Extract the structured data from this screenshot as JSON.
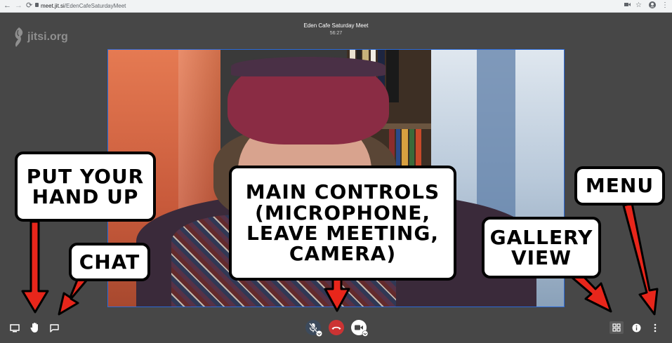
{
  "browser": {
    "nav_back": "←",
    "nav_forward": "→",
    "nav_reload": "⟳",
    "url_host": "meet.jit.si",
    "url_path": "/EdenCafeSaturdayMeet"
  },
  "meeting": {
    "logo_text": "jitsi.org",
    "title": "Eden Cafe Saturday Meet",
    "timer": "56:27"
  },
  "annotations": {
    "hand_up": "PUT YOUR HAND UP",
    "chat": "CHAT",
    "main_controls": "MAIN CONTROLS (MICROPHONE, LEAVE MEETING, CAMERA)",
    "gallery_view": "GALLERY VIEW",
    "menu": "MENU"
  },
  "toolbar": {
    "left": [
      "screen-share-icon",
      "raise-hand-icon",
      "chat-icon"
    ],
    "center": [
      "microphone-icon",
      "hangup-icon",
      "camera-icon"
    ],
    "right": [
      "tile-view-icon",
      "info-icon",
      "more-menu-icon"
    ]
  },
  "colors": {
    "background": "#474747",
    "hangup": "#cc3333",
    "video_border": "#2b6ad8",
    "arrow": "#e8261b"
  }
}
